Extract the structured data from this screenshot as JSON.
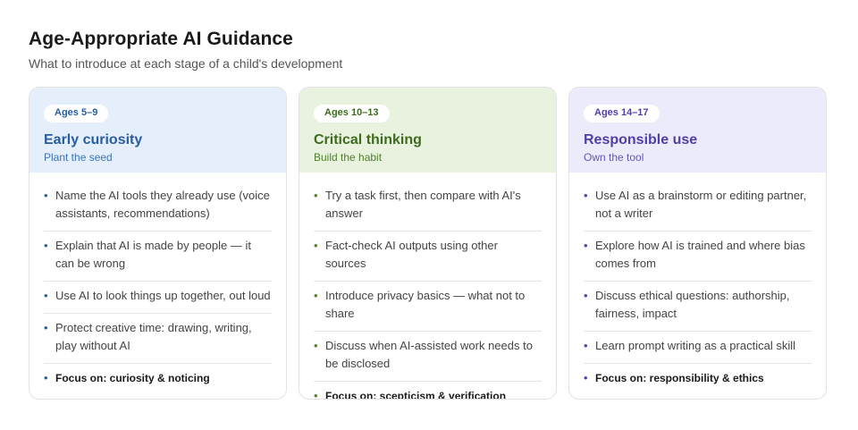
{
  "header": {
    "title": "Age-Appropriate AI Guidance",
    "subtitle": "What to introduce at each stage of a child's development"
  },
  "cards": [
    {
      "badge": "Ages 5–9",
      "title": "Early curiosity",
      "subtitle": "Plant the seed",
      "colors": {
        "head_bg": "#e5effb",
        "accent": "#2a5d9f",
        "sub": "#3b74b8",
        "bullet": "#2a5d9f"
      },
      "items": [
        "Name the AI tools they already use (voice assistants, recommendations)",
        "Explain that AI is made by people — it can be wrong",
        "Use AI to look things up together, out loud",
        "Protect creative time: drawing, writing, play without AI",
        "Focus on: curiosity & noticing"
      ]
    },
    {
      "badge": "Ages 10–13",
      "title": "Critical thinking",
      "subtitle": "Build the habit",
      "colors": {
        "head_bg": "#e8f2df",
        "accent": "#3f6b1f",
        "sub": "#4f7f2c",
        "bullet": "#4f7f2c"
      },
      "items": [
        "Try a task first, then compare with AI's answer",
        "Fact-check AI outputs using other sources",
        "Introduce privacy basics — what not to share",
        "Discuss when AI-assisted work needs to be disclosed",
        "Focus on: scepticism & verification"
      ]
    },
    {
      "badge": "Ages 14–17",
      "title": "Responsible use",
      "subtitle": "Own the tool",
      "colors": {
        "head_bg": "#ecebfc",
        "accent": "#5040a8",
        "sub": "#6455b5",
        "bullet": "#5040a8"
      },
      "items": [
        "Use AI as a brainstorm or editing partner, not a writer",
        "Explore how AI is trained and where bias comes from",
        "Discuss ethical questions: authorship, fairness, impact",
        "Learn prompt writing as a practical skill",
        "Focus on: responsibility & ethics"
      ]
    }
  ]
}
